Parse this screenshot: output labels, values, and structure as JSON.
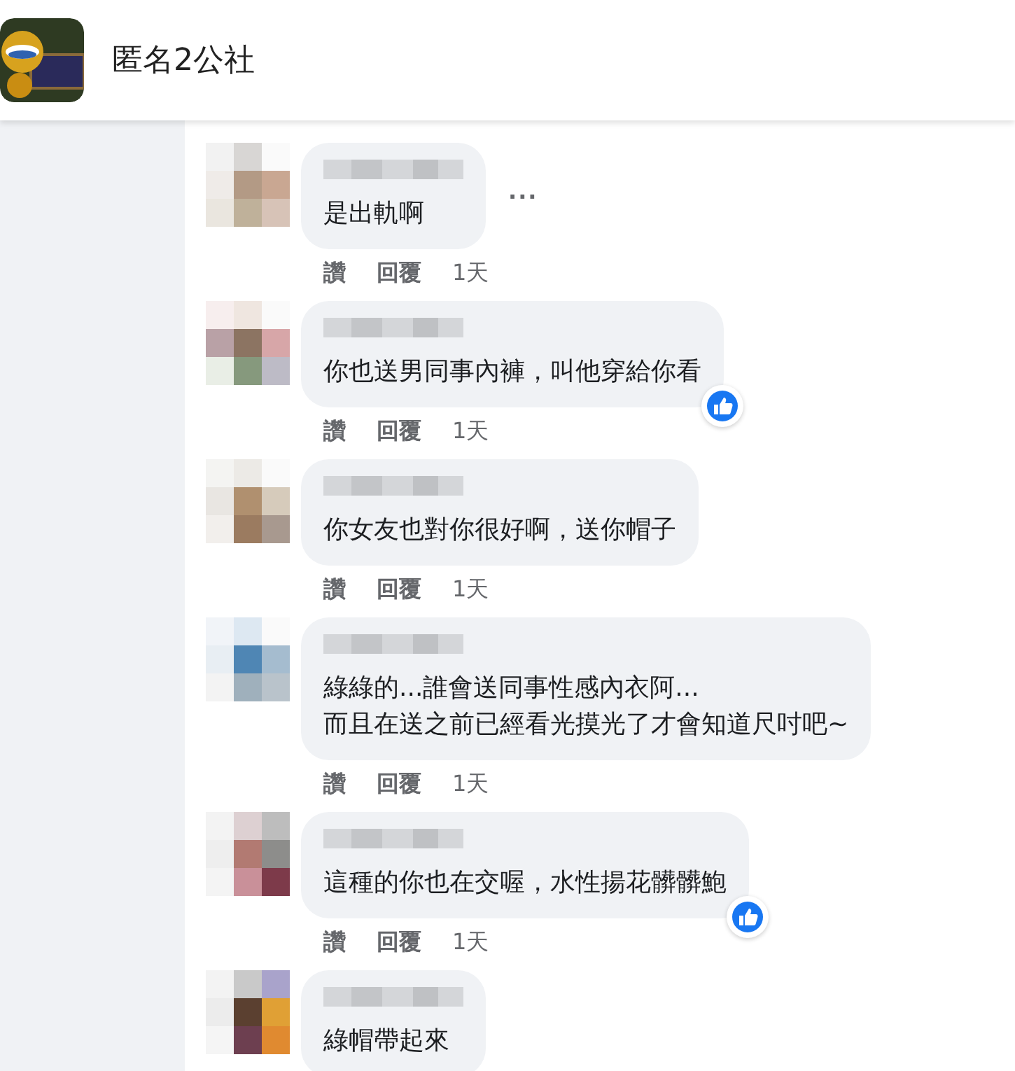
{
  "header": {
    "title": "匿名2公社"
  },
  "comments": [
    {
      "lines": [
        "是出軌啊"
      ],
      "menu": "···",
      "liked": false,
      "actions": [
        "讚",
        "回覆"
      ],
      "time": "1天"
    },
    {
      "lines": [
        "你也送男同事內褲，叫他穿給你看"
      ],
      "liked": true,
      "actions": [
        "讚",
        "回覆"
      ],
      "time": "1天"
    },
    {
      "lines": [
        "你女友也對你很好啊，送你帽子"
      ],
      "liked": false,
      "actions": [
        "讚",
        "回覆"
      ],
      "time": "1天"
    },
    {
      "lines": [
        "綠綠的...誰會送同事性感內衣阿...",
        "而且在送之前已經看光摸光了才會知道尺吋吧~"
      ],
      "liked": false,
      "actions": [
        "讚",
        "回覆"
      ],
      "time": "1天"
    },
    {
      "lines": [
        "這種的你也在交喔，水性揚花髒髒鮑"
      ],
      "liked": true,
      "actions": [
        "讚",
        "回覆"
      ],
      "time": "1天"
    },
    {
      "lines": [
        "綠帽帶起來"
      ],
      "liked": false
    }
  ]
}
